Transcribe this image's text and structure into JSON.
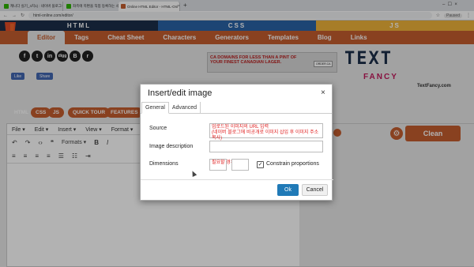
{
  "browser": {
    "tabs": [
      {
        "title": "캐니다 실기_4치1) : 네이버 블로그"
      },
      {
        "title": "좌측에 목편을 직접 등록하는 사"
      },
      {
        "title": "Online HTML Editor - HTML-Onl"
      }
    ],
    "new_tab": "+",
    "url": "html-online.com/editor/",
    "profile": "Paused"
  },
  "site": {
    "lang_tabs": [
      {
        "label": "HTML",
        "color": "#1c2f4a"
      },
      {
        "label": "CSS",
        "color": "#2a63a6"
      },
      {
        "label": "JS",
        "color": "#f0b43a"
      }
    ],
    "nav": [
      "Editor",
      "Tags",
      "Cheat Sheet",
      "Characters",
      "Generators",
      "Templates",
      "Blog",
      "Links"
    ],
    "social": [
      "f",
      "t",
      "in",
      "digg",
      "B",
      "r"
    ],
    "like": "Like",
    "share": "Share",
    "ad_text": "CA DOMAINS FOR LESS THAN A PINT OF YOUR FINEST CANADIAN LAGER.",
    "ad_button": "ORDER.CA",
    "brand_line1": "TEXT",
    "brand_line2": "FANCY",
    "brand_url": "TextFancy.com",
    "pills": [
      {
        "label": "HTML",
        "color": "#c45d2f"
      },
      {
        "label": "CSS",
        "color": "#c45d2f"
      },
      {
        "label": "JS",
        "color": "#c45d2f"
      },
      {
        "label": "QUICK TOUR",
        "color": "#c45d2f"
      },
      {
        "label": "FEATURES",
        "color": "#c45d2f"
      }
    ],
    "clean_button": "Clean"
  },
  "editor": {
    "menu": [
      "File ▾",
      "Edit ▾",
      "Insert ▾",
      "View ▾",
      "Format ▾"
    ],
    "formats_label": "Formats ▾"
  },
  "dialog": {
    "title": "Insert/edit image",
    "close": "×",
    "tabs": [
      "General",
      "Advanced"
    ],
    "source_label": "Source",
    "source_value": "업로드된 이미지의 URL 입력\n(네이버 블로그에 비공개로 이미지 삽입 후 이미지 주소 복사)",
    "description_label": "Image description",
    "description_value": "",
    "dimensions_label": "Dimensions",
    "width_value": "필요할 경우에만",
    "height_value": "",
    "constrain_label": "Constrain proportions",
    "constrain_checked": true,
    "ok": "Ok",
    "cancel": "Cancel"
  },
  "colors": {
    "brand": "#c45d2f",
    "ok_button": "#207ab7",
    "annotation_red": "#e02020"
  }
}
